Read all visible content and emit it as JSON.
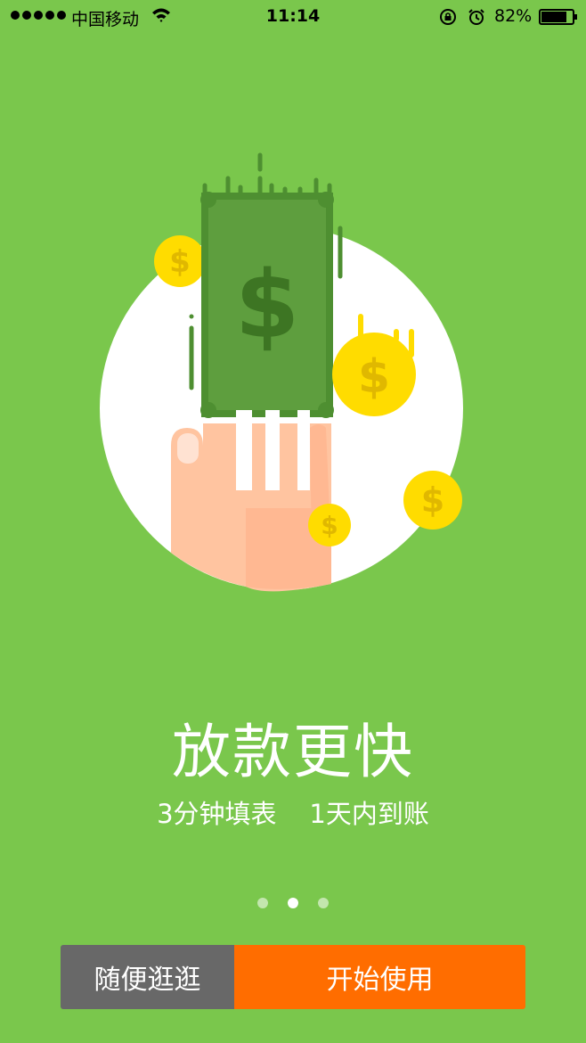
{
  "status_bar": {
    "carrier": "中国移动",
    "time": "11:14",
    "battery": "82%",
    "icons": [
      "signal-dots",
      "wifi-icon",
      "rotation-lock-icon",
      "alarm-icon",
      "battery-icon"
    ]
  },
  "slide": {
    "title": "放款更快",
    "subtitle": "3分钟填表    1天内到账",
    "page_count": 3,
    "active_page": 2
  },
  "buttons": {
    "browse_label": "随便逛逛",
    "start_label": "开始使用"
  },
  "colors": {
    "background": "#7ac74c",
    "bill": "#5e9e3e",
    "coin": "#ffdc00",
    "browse_button": "#686868",
    "start_button": "#ff6d00"
  }
}
